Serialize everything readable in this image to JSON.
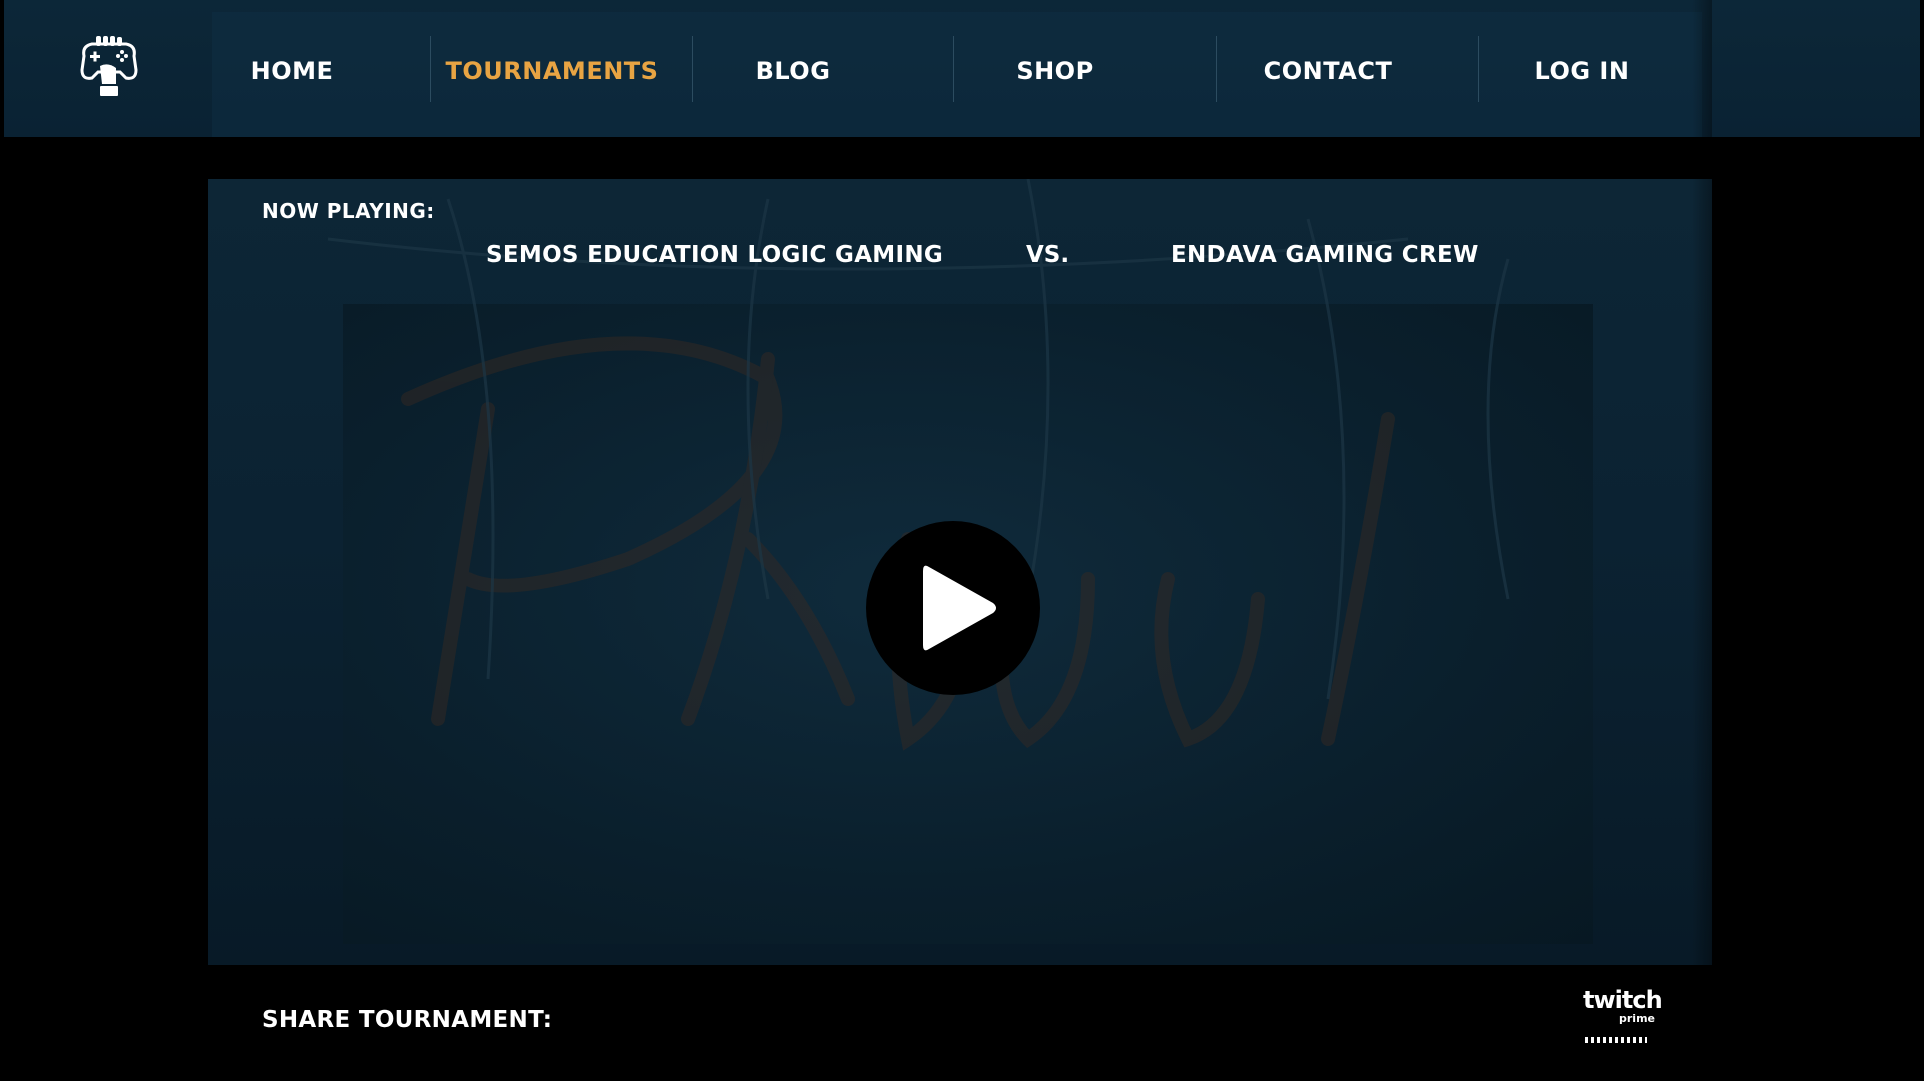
{
  "header": {
    "nav": [
      {
        "label": "HOME",
        "active": false
      },
      {
        "label": "TOURNAMENTS",
        "active": true
      },
      {
        "label": "BLOG",
        "active": false
      },
      {
        "label": "SHOP",
        "active": false
      },
      {
        "label": "CONTACT",
        "active": false
      },
      {
        "label": "LOG IN",
        "active": false
      }
    ]
  },
  "now_playing": {
    "label": "NOW PLAYING:",
    "team_a": "SEMOS EDUCATION LOGIC GAMING",
    "vs": "VS.",
    "team_b": "ENDAVA GAMING CREW"
  },
  "share": {
    "label": "SHARE TOURNAMENT:"
  },
  "twitch": {
    "name": "twitch",
    "sub": "prime"
  },
  "colors": {
    "header_bg": "#0c2738",
    "accent": "#e8a443",
    "video_bg": "#0b2232",
    "text": "#ffffff"
  },
  "icons": {
    "logo": "gamepad-hand-icon",
    "play": "play-icon",
    "twitch": "twitch-prime-logo"
  }
}
